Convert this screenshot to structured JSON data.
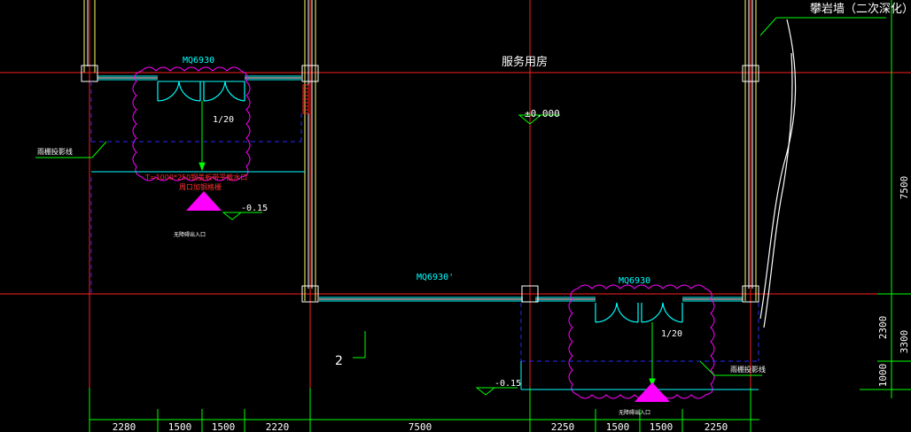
{
  "room_label": "服务用房",
  "wall_note": "攀岩墙（二次深化）",
  "elevation_main": "±0.000",
  "door_top_left": "MQ6930",
  "door_middle": "MQ6930'",
  "door_bottom_right": "MQ6930",
  "slope_left": "1/20",
  "slope_right": "1/20",
  "canopy_left": "雨棚投影线",
  "canopy_right": "雨棚投影线",
  "elev_left": "-0.15",
  "elev_right": "-0.15",
  "trench_note_line1": "T=1000*250钢盖板带平截水口",
  "trench_note_line2": "周口加钢格栅",
  "entry_left": "无障碍出入口",
  "entry_right": "无障碍出入口",
  "axis_mark": "2",
  "dims_bottom_left": [
    "2280",
    "1500",
    "1500",
    "2220"
  ],
  "dim_bottom_middle": "7500",
  "dims_bottom_right": [
    "2250",
    "1500",
    "1500",
    "2250"
  ],
  "dim_right_vertical": "7500",
  "dims_right_lower": [
    "2300",
    "3300",
    "1000"
  ],
  "colors": {
    "background": "#000000",
    "axis": "#ff2020",
    "wall": "#ffffff",
    "cyan": "#00ffff",
    "magenta": "#ff00ff",
    "blue_dash": "#2a2aff",
    "yellow": "#ffff66",
    "green": "#00ff00",
    "text": "#ffffff"
  }
}
